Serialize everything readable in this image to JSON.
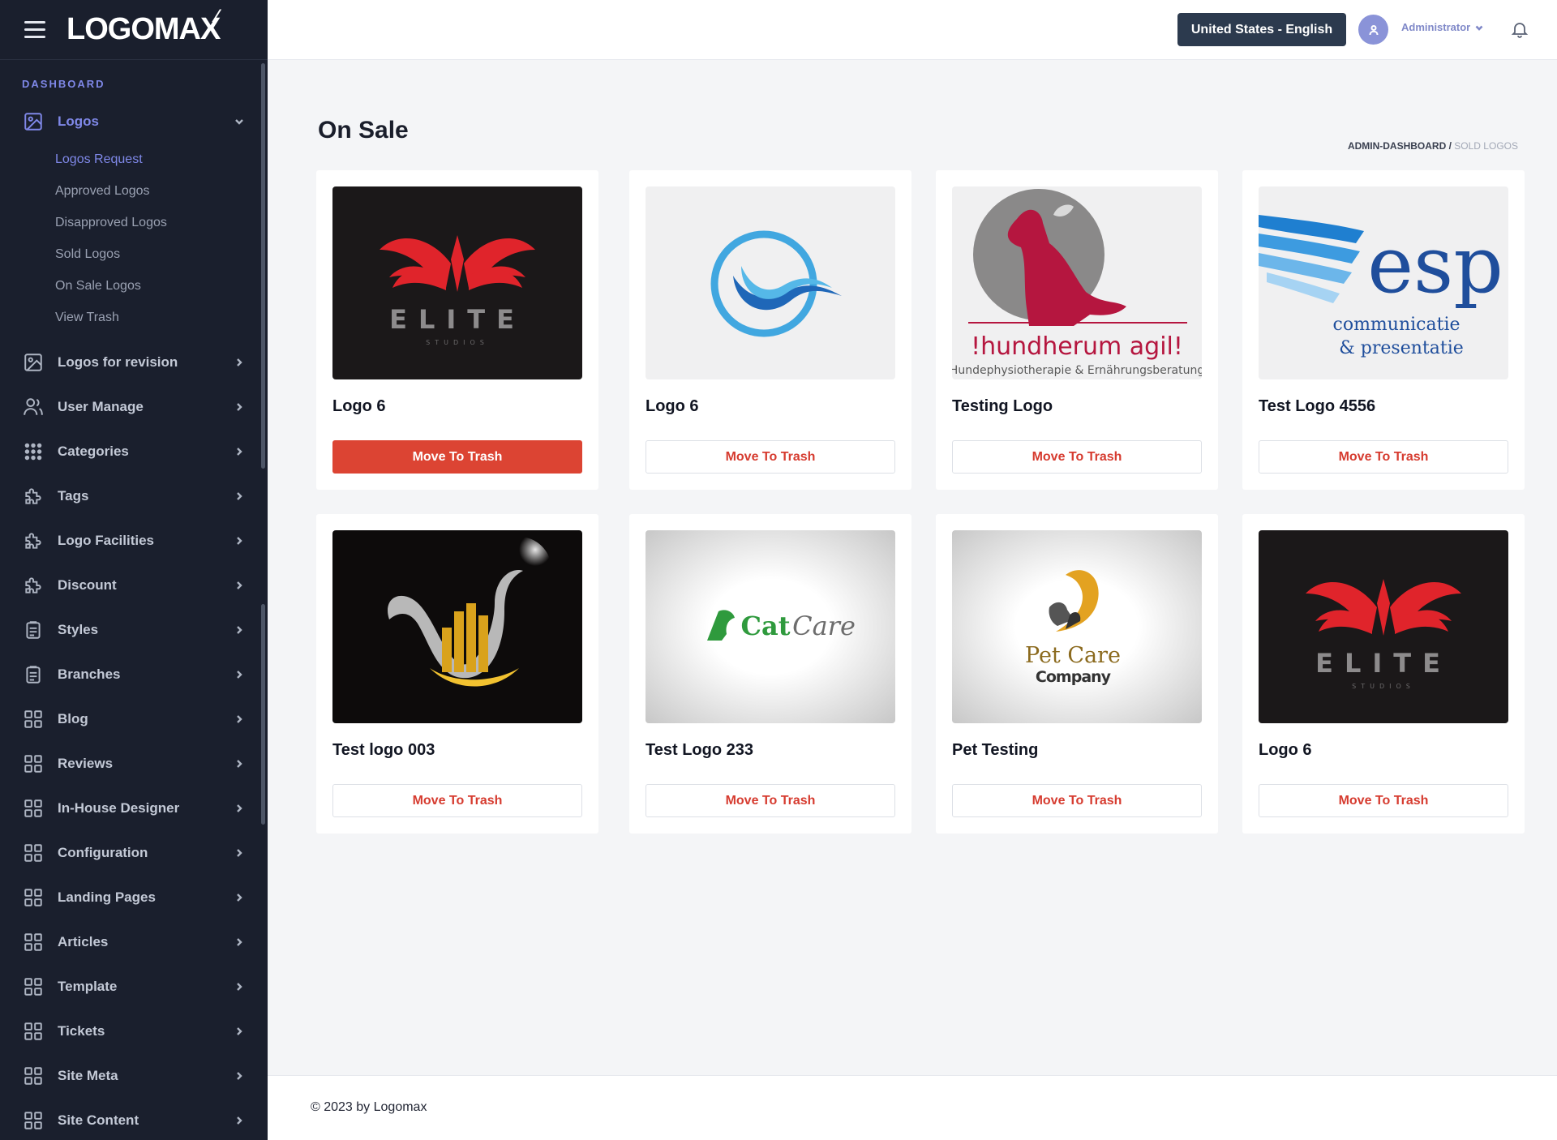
{
  "brand": {
    "name": "LOGOMAX"
  },
  "sidebar": {
    "section_label": "DASHBOARD",
    "logos_menu": {
      "label": "Logos",
      "sub_items": [
        {
          "label": "Logos Request"
        },
        {
          "label": "Approved Logos"
        },
        {
          "label": "Disapproved Logos"
        },
        {
          "label": "Sold Logos"
        },
        {
          "label": "On Sale Logos"
        },
        {
          "label": "View Trash"
        }
      ]
    },
    "items": [
      {
        "label": "Logos for revision",
        "icon": "image-icon"
      },
      {
        "label": "User Manage",
        "icon": "users-icon"
      },
      {
        "label": "Categories",
        "icon": "dots-grid-icon"
      },
      {
        "label": "Tags",
        "icon": "puzzle-icon"
      },
      {
        "label": "Logo Facilities",
        "icon": "puzzle-icon"
      },
      {
        "label": "Discount",
        "icon": "puzzle-icon"
      },
      {
        "label": "Styles",
        "icon": "clipboard-icon"
      },
      {
        "label": "Branches",
        "icon": "clipboard-icon"
      },
      {
        "label": "Blog",
        "icon": "grid-icon"
      },
      {
        "label": "Reviews",
        "icon": "grid-icon"
      },
      {
        "label": "In-House Designer",
        "icon": "grid-icon"
      },
      {
        "label": "Configuration",
        "icon": "grid-icon"
      },
      {
        "label": "Landing Pages",
        "icon": "grid-icon"
      },
      {
        "label": "Articles",
        "icon": "grid-icon"
      },
      {
        "label": "Template",
        "icon": "grid-icon"
      },
      {
        "label": "Tickets",
        "icon": "grid-icon"
      },
      {
        "label": "Site Meta",
        "icon": "grid-icon"
      },
      {
        "label": "Site Content",
        "icon": "grid-icon"
      }
    ]
  },
  "header": {
    "language": "United States - English",
    "user_name": "Administrator"
  },
  "page": {
    "title": "On Sale",
    "breadcrumb": {
      "parent": "ADMIN-DASHBOARD",
      "separator": "/",
      "current": "SOLD LOGOS"
    }
  },
  "cards": [
    {
      "title": "Logo 6",
      "button": "Move To Trash",
      "image": "elite-studios-logo",
      "image_text": "ELITE",
      "image_subtext": "STUDIOS"
    },
    {
      "title": "Logo 6",
      "button": "Move To Trash",
      "image": "blue-wave-circle-logo"
    },
    {
      "title": "Testing Logo",
      "button": "Move To Trash",
      "image": "hundherum-agil-logo",
      "image_text": "!hundherum agil!",
      "image_subtext": "Hundephysiotherapie & Ernährungsberatung"
    },
    {
      "title": "Test Logo 4556",
      "button": "Move To Trash",
      "image": "esp-logo",
      "image_text": "esp",
      "image_subtext": "communicatie",
      "image_subtext2": "& presentatie"
    },
    {
      "title": "Test logo 003",
      "button": "Move To Trash",
      "image": "gold-building-logo"
    },
    {
      "title": "Test Logo 233",
      "button": "Move To Trash",
      "image": "cat-care-logo",
      "image_text": "Cat",
      "image_subtext": "Care"
    },
    {
      "title": "Pet Testing",
      "button": "Move To Trash",
      "image": "pet-care-company-logo",
      "image_text": "Pet Care",
      "image_subtext": "Company"
    },
    {
      "title": "Logo 6",
      "button": "Move To Trash",
      "image": "elite-studios-logo",
      "image_text": "ELITE",
      "image_subtext": "STUDIOS"
    }
  ],
  "footer": {
    "text": "© 2023 by Logomax"
  },
  "colors": {
    "sidebar_bg": "#1a1f2d",
    "accent": "#7f88e8",
    "danger": "#dc4433",
    "lang_btn": "#2c3a4e"
  }
}
